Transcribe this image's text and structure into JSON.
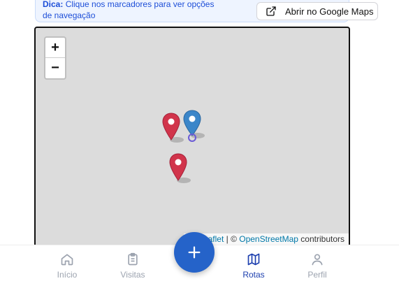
{
  "tip": {
    "label": "Dica:",
    "text": "Clique nos marcadores para ver opções de navegação"
  },
  "google_maps_button": {
    "label": "Abrir no Google Maps",
    "icon": "external-link-icon"
  },
  "map": {
    "zoom_in": "+",
    "zoom_out": "−",
    "markers": [
      {
        "color": "#d1344b",
        "kind": "destination"
      },
      {
        "color": "#3b86c9",
        "kind": "current"
      },
      {
        "color": "#d1344b",
        "kind": "destination"
      }
    ],
    "attribution": {
      "leaflet": "Leaflet",
      "separator": " | © ",
      "osm": "OpenStreetMap",
      "suffix": " contributors"
    }
  },
  "nav": {
    "items": [
      {
        "label": "Início",
        "icon": "home-icon",
        "active": false
      },
      {
        "label": "Visitas",
        "icon": "clipboard-icon",
        "active": false
      },
      {
        "label": "Rotas",
        "icon": "map-icon",
        "active": true
      },
      {
        "label": "Perfil",
        "icon": "user-icon",
        "active": false
      }
    ],
    "fab_icon": "plus-icon"
  },
  "colors": {
    "accent": "#2563c9",
    "active_nav": "#1e40af",
    "tip_text": "#1d4ed8"
  }
}
